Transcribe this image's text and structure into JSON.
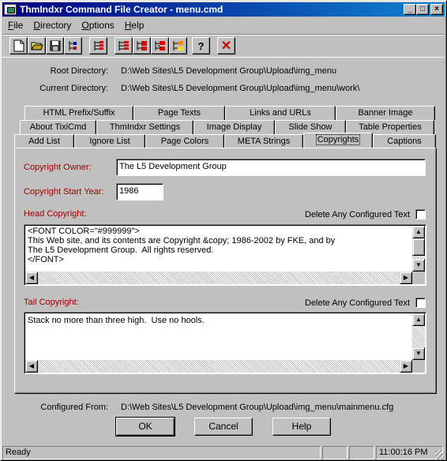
{
  "window": {
    "title": "ThmIndxr Command File Creator - menu.cmd",
    "minimize_glyph": "_",
    "maximize_glyph": "□",
    "close_glyph": "×"
  },
  "menu": [
    {
      "label": "File",
      "ul": "F",
      "rest": "ile"
    },
    {
      "label": "Directory",
      "ul": "D",
      "rest": "irectory"
    },
    {
      "label": "Options",
      "ul": "O",
      "rest": "ptions"
    },
    {
      "label": "Help",
      "ul": "H",
      "rest": "elp"
    }
  ],
  "toolbar_icons": [
    "new-file-icon",
    "open-folder-icon",
    "save-disk-icon",
    "tree-icon",
    "tree-split-icon",
    "tree-add-icon",
    "tree-red-icon",
    "tree-remove-icon",
    "tree-color-icon",
    "help-question-icon",
    "stop-x-icon"
  ],
  "toolbar": {
    "help_glyph": "?",
    "stop_glyph": "✕"
  },
  "paths": {
    "root_label": "Root Directory:",
    "root_value": "D:\\Web Sites\\L5 Development Group\\Upload\\img_menu",
    "current_label": "Current Directory:",
    "current_value": "D:\\Web Sites\\L5 Development Group\\Upload\\img_menu\\work\\",
    "configured_label": "Configured From:",
    "configured_value": "D:\\Web Sites\\L5 Development Group\\Upload\\img_menu\\mainmenu.cfg"
  },
  "tabs": {
    "row1": [
      "HTML Prefix/Suffix",
      "Page Texts",
      "Links and URLs",
      "Banner Image"
    ],
    "row2": [
      "About TixiCmd",
      "ThmIndxr Settings",
      "Image Display",
      "Slide Show",
      "Table Properties"
    ],
    "row3": [
      "Add List",
      "Ignore List",
      "Page Colors",
      "META Strings",
      "Copyrights",
      "Captions"
    ],
    "active": "Copyrights"
  },
  "copyright": {
    "owner_label": "Copyright Owner:",
    "owner_value": "The L5 Development Group",
    "start_year_label": "Copyright Start Year:",
    "start_year_value": "1986",
    "head_label": "Head Copyright:",
    "head_delete_label": "Delete Any Configured Text",
    "head_text": "<FONT COLOR=\"#999999\">\nThis Web site, and its contents are Copyright &copy; 1986-2002 by FKE, and by\nThe L5 Development Group.  All rights reserved.\n</FONT>",
    "tail_label": "Tail Copyright:",
    "tail_delete_label": "Delete Any Configured Text",
    "tail_text": "Stack no more than three high.  Use no hools."
  },
  "scroll_glyphs": {
    "up": "▲",
    "down": "▼",
    "left": "◀",
    "right": "▶"
  },
  "buttons": {
    "ok": "OK",
    "cancel": "Cancel",
    "help": "Help"
  },
  "status": {
    "text": "Ready",
    "time": "11:00:16 PM"
  }
}
